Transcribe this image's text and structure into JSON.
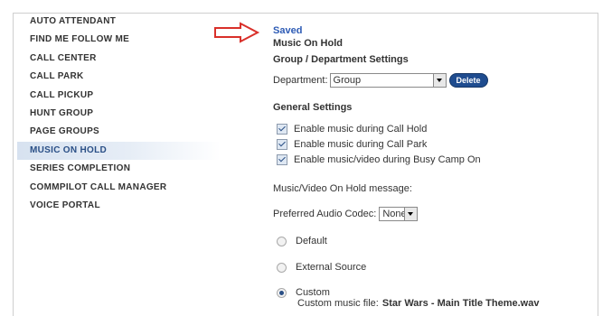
{
  "sidebar": {
    "items": [
      {
        "label": "AUTO ATTENDANT"
      },
      {
        "label": "FIND ME FOLLOW ME"
      },
      {
        "label": "CALL CENTER"
      },
      {
        "label": "CALL PARK"
      },
      {
        "label": "CALL PICKUP"
      },
      {
        "label": "HUNT GROUP"
      },
      {
        "label": "PAGE GROUPS"
      },
      {
        "label": "MUSIC ON HOLD"
      },
      {
        "label": "SERIES COMPLETION"
      },
      {
        "label": "COMMPILOT CALL MANAGER"
      },
      {
        "label": "VOICE PORTAL"
      }
    ],
    "active_index": 7
  },
  "main": {
    "status": "Saved",
    "title": "Music On Hold",
    "group_section": "Group / Department Settings",
    "department_label": "Department:",
    "department_value": "Group",
    "delete_label": "Delete",
    "general_section": "General Settings",
    "checkboxes": [
      {
        "label": "Enable music during Call Hold",
        "checked": true
      },
      {
        "label": "Enable music during Call Park",
        "checked": true
      },
      {
        "label": "Enable music/video during Busy Camp On",
        "checked": true
      }
    ],
    "message_label": "Music/Video On Hold message:",
    "codec_label": "Preferred Audio Codec:",
    "codec_value": "None",
    "radios": {
      "default": "Default",
      "external": "External Source",
      "custom": "Custom",
      "custom_file_label": "Custom music file:",
      "custom_file_value": "Star Wars - Main Title Theme.wav",
      "selected": "custom"
    }
  },
  "colors": {
    "accent": "#2d5bb5",
    "button": "#1f4c8f",
    "arrow": "#d9302a"
  },
  "icons": {
    "pointer": "arrow-right-icon",
    "dropdown": "chevron-down-icon"
  }
}
